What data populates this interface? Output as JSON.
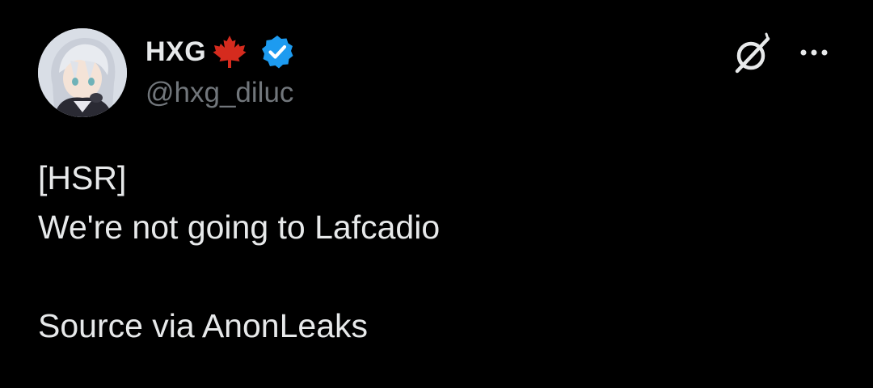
{
  "tweet": {
    "author": {
      "display_name": "HXG",
      "flag_icon": "canada-maple-leaf-icon",
      "verified_icon": "verified-badge-icon",
      "handle": "@hxg_diluc",
      "avatar": "anime-avatar-silver-hair"
    },
    "actions": {
      "grok_icon": "grok-icon",
      "more_icon": "more-options-icon"
    },
    "text_lines": [
      "[HSR]",
      "We're not going to Lafcadio",
      "",
      "Source via AnonLeaks"
    ]
  },
  "colors": {
    "background": "#000000",
    "text_primary": "#e7e9ea",
    "text_secondary": "#71767b",
    "verified_blue": "#1d9bf0",
    "maple_red": "#d52b1e"
  }
}
